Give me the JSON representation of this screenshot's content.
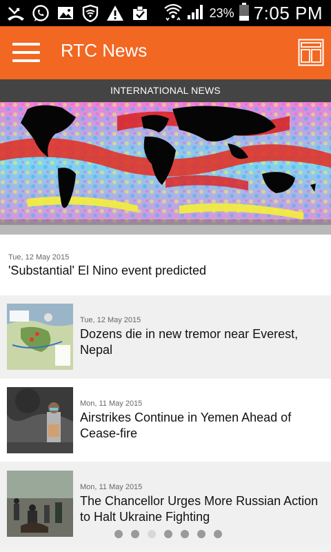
{
  "status_bar": {
    "left_icons": [
      "missed-call-icon",
      "whatsapp-icon",
      "gallery-icon",
      "vpn-shield-icon",
      "warning-icon",
      "clipboard-check-icon"
    ],
    "battery_percent": "23%",
    "time": "7:05 PM"
  },
  "app_bar": {
    "title": "RTC News",
    "menu_icon": "hamburger-icon",
    "layout_icon": "layout-toggle-icon",
    "color": "#f26722"
  },
  "section": {
    "label": "INTERNATIONAL NEWS"
  },
  "hero": {
    "date": "Tue, 12 May 2015",
    "title": "'Substantial' El Nino event predicted"
  },
  "articles": [
    {
      "date": "Tue, 12 May 2015",
      "title": "Dozens die in new tremor near Everest, Nepal"
    },
    {
      "date": "Mon, 11 May 2015",
      "title": "Airstrikes Continue in Yemen Ahead of Cease-fire"
    },
    {
      "date": "Mon, 11 May 2015",
      "title": "The Chancellor Urges More Russian Action to Halt Ukraine Fighting"
    }
  ],
  "pager": {
    "count": 7,
    "active_index": 2
  }
}
